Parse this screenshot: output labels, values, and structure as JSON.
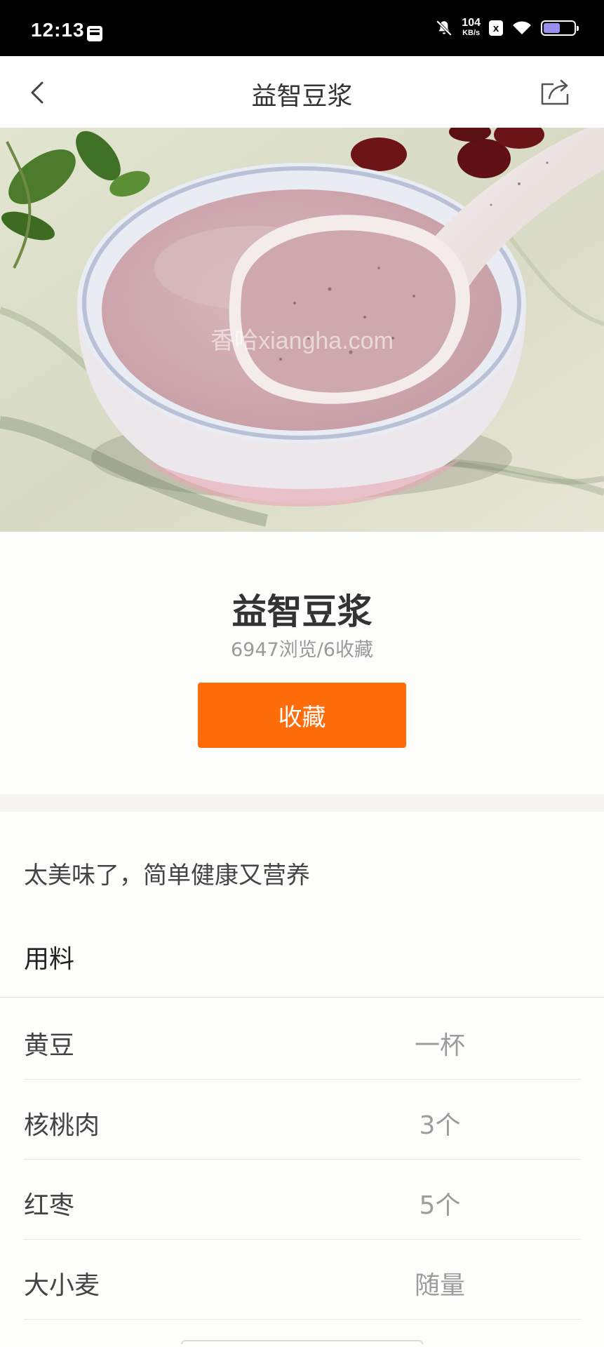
{
  "status_bar": {
    "time": "12:13",
    "net_speed_value": "104",
    "net_speed_unit": "KB/s",
    "sim_badge": "x",
    "battery_color": "#9a8df0"
  },
  "nav": {
    "title": "益智豆浆",
    "back_icon": "chevron-left-icon",
    "share_icon": "share-icon"
  },
  "hero": {
    "watermark": "香哈xiangha.com"
  },
  "recipe": {
    "title": "益智豆浆",
    "stats": "6947浏览/6收藏",
    "favorite_label": "收藏",
    "description": "太美味了，简单健康又营养"
  },
  "ingredients": {
    "heading": "用料",
    "items": [
      {
        "name": "黄豆",
        "amount": "一杯"
      },
      {
        "name": "核桃肉",
        "amount": "3个"
      },
      {
        "name": "红枣",
        "amount": "5个"
      },
      {
        "name": "大小麦",
        "amount": "随量"
      }
    ]
  },
  "colors": {
    "accent": "#ff6d0a",
    "divider": "#f6f4ef"
  }
}
